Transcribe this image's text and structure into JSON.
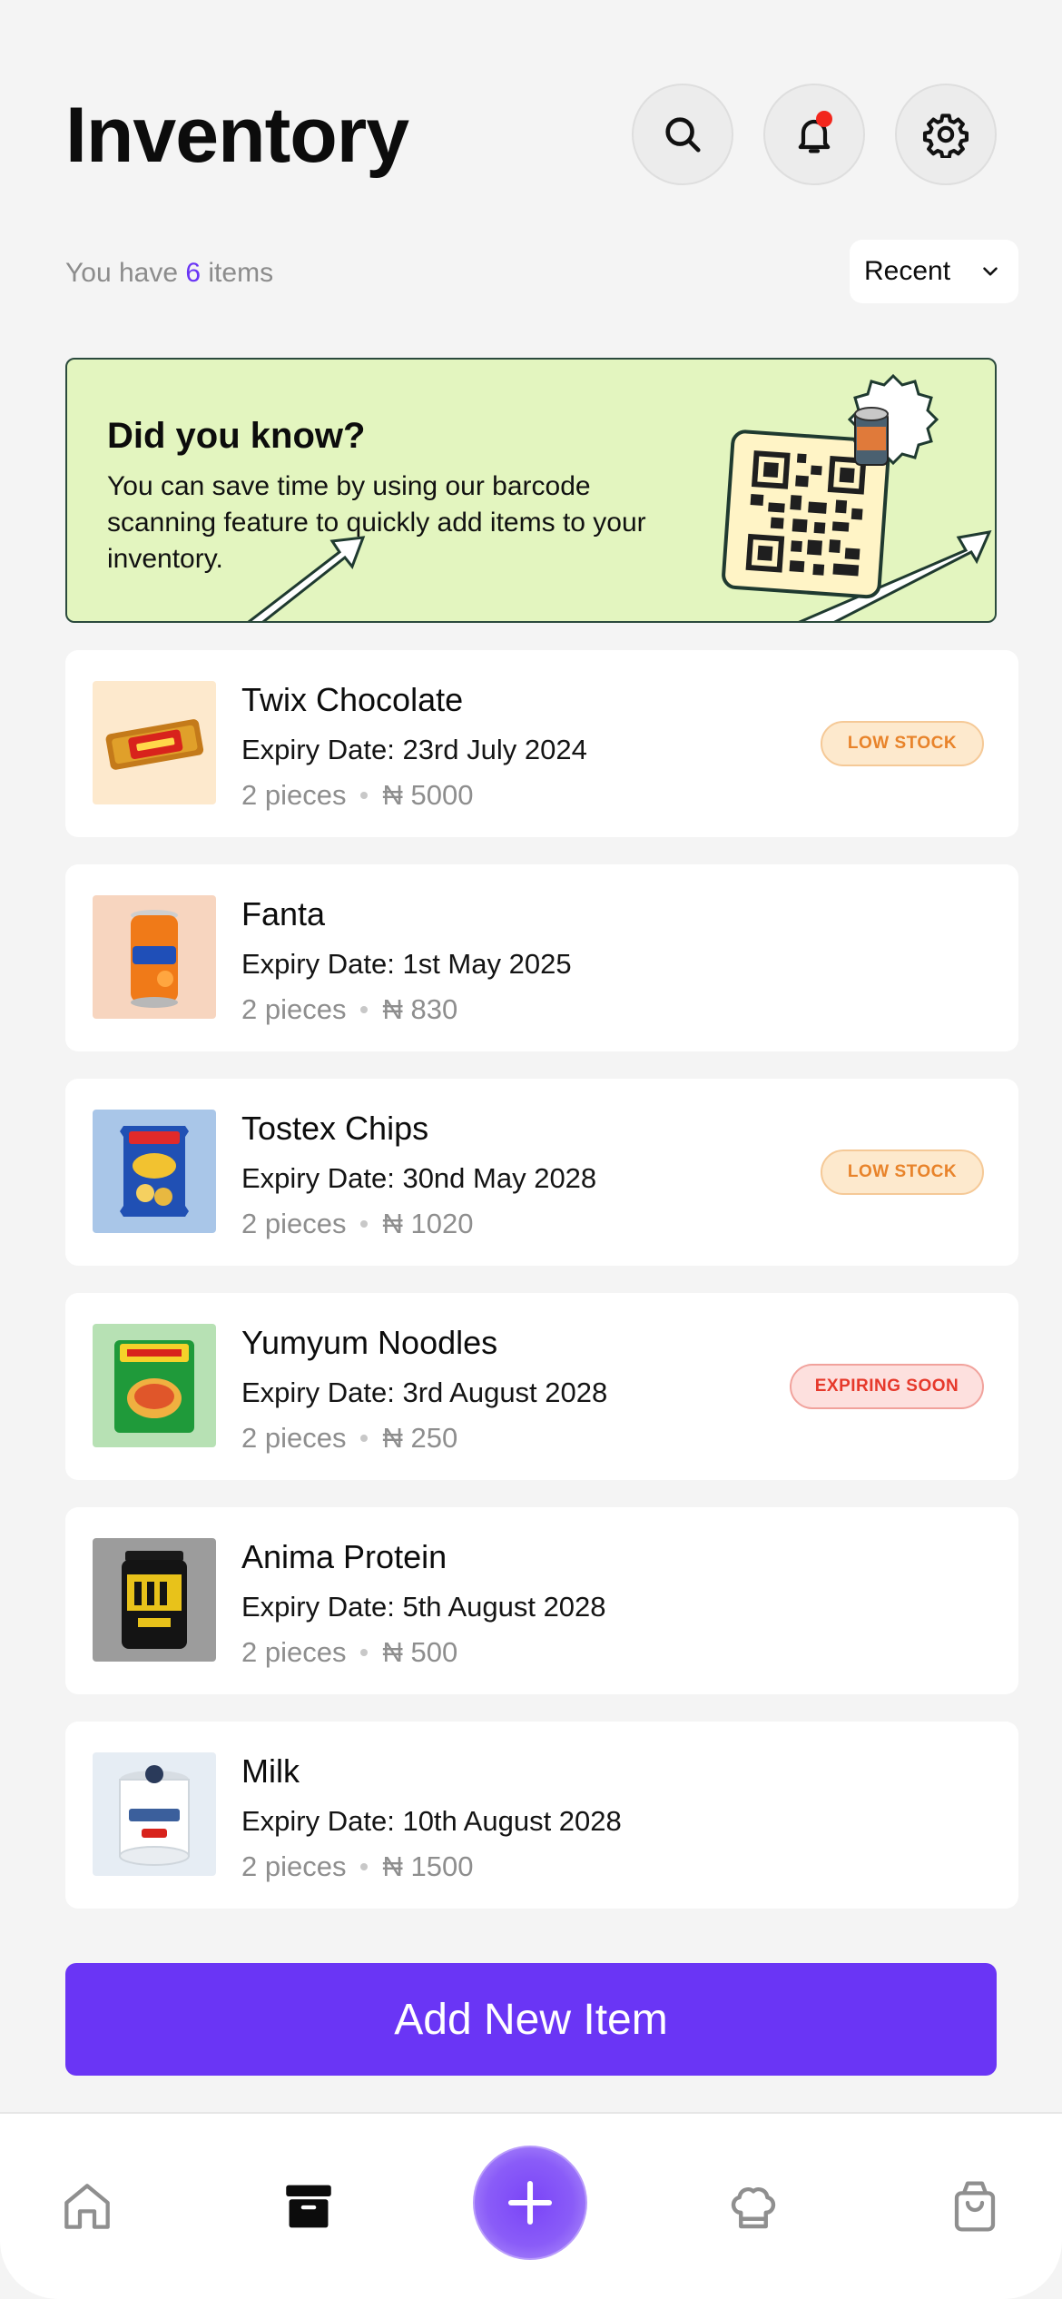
{
  "header": {
    "title": "Inventory"
  },
  "summary": {
    "prefix": "You have",
    "count": "6",
    "suffix": "items"
  },
  "sort": {
    "selected": "Recent"
  },
  "banner": {
    "title": "Did you know?",
    "text": "You can save time by using our barcode scanning feature to quickly add items to your inventory."
  },
  "currency_symbol": "₦",
  "items": [
    {
      "name": "Twix Chocolate",
      "expiry": "Expiry Date: 23rd July 2024",
      "qty": "2 pieces",
      "price": "₦ 5000",
      "badge": "LOW STOCK"
    },
    {
      "name": "Fanta",
      "expiry": "Expiry Date: 1st May 2025",
      "qty": "2 pieces",
      "price": "₦ 830",
      "badge": ""
    },
    {
      "name": "Tostex Chips",
      "expiry": "Expiry Date: 30nd May 2028",
      "qty": "2 pieces",
      "price": "₦ 1020",
      "badge": "LOW STOCK"
    },
    {
      "name": "Yumyum Noodles",
      "expiry": "Expiry Date: 3rd August 2028",
      "qty": "2 pieces",
      "price": "₦ 250",
      "badge": "EXPIRING SOON"
    },
    {
      "name": "Anima Protein",
      "expiry": "Expiry Date: 5th August 2028",
      "qty": "2 pieces",
      "price": "₦ 500",
      "badge": ""
    },
    {
      "name": "Milk",
      "expiry": "Expiry Date: 10th August 2028",
      "qty": "2 pieces",
      "price": "₦ 1500",
      "badge": ""
    }
  ],
  "actions": {
    "add_label": "Add New Item"
  },
  "nav": {
    "items": [
      "home-icon",
      "inventory-box-icon",
      "plus-icon",
      "chef-hat-icon",
      "shopping-bag-icon"
    ],
    "active": "inventory-box-icon"
  },
  "colors": {
    "accent": "#6a35f5",
    "banner_bg": "#e3f5bf",
    "low_stock": "#e8832a",
    "expiring": "#e6392b",
    "notification_dot": "#f2261c"
  }
}
